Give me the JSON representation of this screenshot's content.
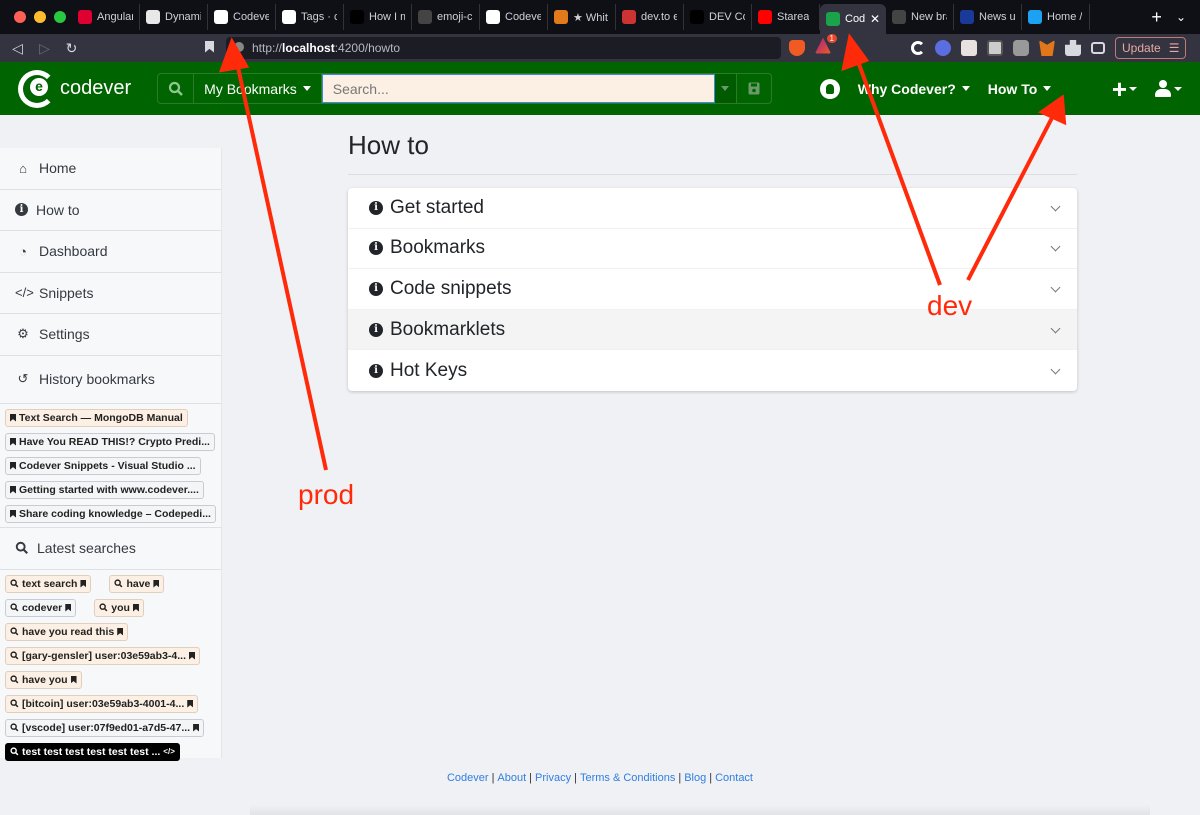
{
  "browser": {
    "tabs": [
      {
        "label": "Angular",
        "icon": "angular-icon",
        "color": "#dd0031"
      },
      {
        "label": "Dynami",
        "icon": "dynamic-icon",
        "color": "#e8e8e8"
      },
      {
        "label": "Codever",
        "icon": "codever-icon",
        "color": "#ffffff"
      },
      {
        "label": "Tags · c",
        "icon": "github-icon",
        "color": "#ffffff"
      },
      {
        "label": "How I m",
        "icon": "dev-icon",
        "color": "#000000"
      },
      {
        "label": "emoji-c",
        "icon": "github-icon",
        "color": "#444444"
      },
      {
        "label": "Codever",
        "icon": "github-icon",
        "color": "#ffffff"
      },
      {
        "label": "★ Whit",
        "icon": "shield-icon",
        "color": "#e07a1a"
      },
      {
        "label": "dev.to e",
        "icon": "brave-icon",
        "color": "#c33"
      },
      {
        "label": "DEV Co",
        "icon": "dev-icon",
        "color": "#000000"
      },
      {
        "label": "Starea",
        "icon": "youtube-icon",
        "color": "#ff0000"
      },
      {
        "label": "Code",
        "icon": "codever-icon",
        "color": "#1aa34a",
        "active": true
      },
      {
        "label": "New bra",
        "icon": "github-icon",
        "color": "#444444"
      },
      {
        "label": "News u",
        "icon": "hz-icon",
        "color": "#1a3a9a"
      },
      {
        "label": "Home /",
        "icon": "twitter-icon",
        "color": "#1da1f2"
      }
    ],
    "url_prefix": "http://",
    "url_host": "localhost",
    "url_rest": ":4200/howto",
    "shields_badge": "1",
    "update_label": "Update"
  },
  "navbar": {
    "brand": "codever",
    "search_scope": "My Bookmarks",
    "search_placeholder": "Search...",
    "links": [
      {
        "label": "Why Codever?"
      },
      {
        "label": "How To"
      }
    ]
  },
  "sidebar": {
    "items": [
      {
        "label": "Home",
        "icon": "home-icon",
        "glyph": "⌂"
      },
      {
        "label": "How to",
        "icon": "info-circle-icon",
        "glyph": "i"
      },
      {
        "label": "Dashboard",
        "icon": "dashboard-icon",
        "glyph": "◔"
      },
      {
        "label": "Snippets",
        "icon": "code-icon",
        "glyph": "</>"
      },
      {
        "label": "Settings",
        "icon": "gear-icon",
        "glyph": "⚙"
      }
    ],
    "history_title": "History bookmarks",
    "history": [
      {
        "label": "Text Search — MongoDB Manual",
        "style": "tan"
      },
      {
        "label": "Have You READ THIS!? Crypto Predi...",
        "style": "light"
      },
      {
        "label": "Codever Snippets - Visual Studio ...",
        "style": "light"
      },
      {
        "label": "Getting started with www.codever....",
        "style": "light"
      },
      {
        "label": "Share coding knowledge – Codepedi...",
        "style": "light"
      }
    ],
    "searches_title": "Latest searches",
    "searches": [
      {
        "label": "text search",
        "style": "tan",
        "end": "bookmark"
      },
      {
        "label": "have",
        "style": "tan",
        "end": "bookmark"
      },
      {
        "label": "codever",
        "style": "light",
        "end": "bookmark"
      },
      {
        "label": "you",
        "style": "tan",
        "end": "bookmark"
      },
      {
        "label": "have you read this",
        "style": "tan",
        "end": "bookmark"
      },
      {
        "label": "[gary-gensler] user:03e59ab3-4...",
        "style": "tan",
        "end": "bookmark"
      },
      {
        "label": "have you",
        "style": "tan",
        "end": "bookmark"
      },
      {
        "label": "[bitcoin] user:03e59ab3-4001-4...",
        "style": "tan",
        "end": "bookmark"
      },
      {
        "label": "[vscode] user:07f9ed01-a7d5-47...",
        "style": "light",
        "end": "bookmark"
      },
      {
        "label": "test test test test test test ...",
        "style": "dark",
        "end": "code"
      }
    ]
  },
  "main": {
    "title": "How to",
    "sections": [
      {
        "label": "Get started"
      },
      {
        "label": "Bookmarks"
      },
      {
        "label": "Code snippets"
      },
      {
        "label": "Bookmarklets"
      },
      {
        "label": "Hot Keys"
      }
    ]
  },
  "footer": {
    "links": [
      "Codever",
      "About",
      "Privacy",
      "Terms & Conditions",
      "Blog",
      "Contact"
    ]
  },
  "annotations": {
    "prod_label": "prod",
    "dev_label": "dev",
    "color": "#ff2a0a"
  }
}
